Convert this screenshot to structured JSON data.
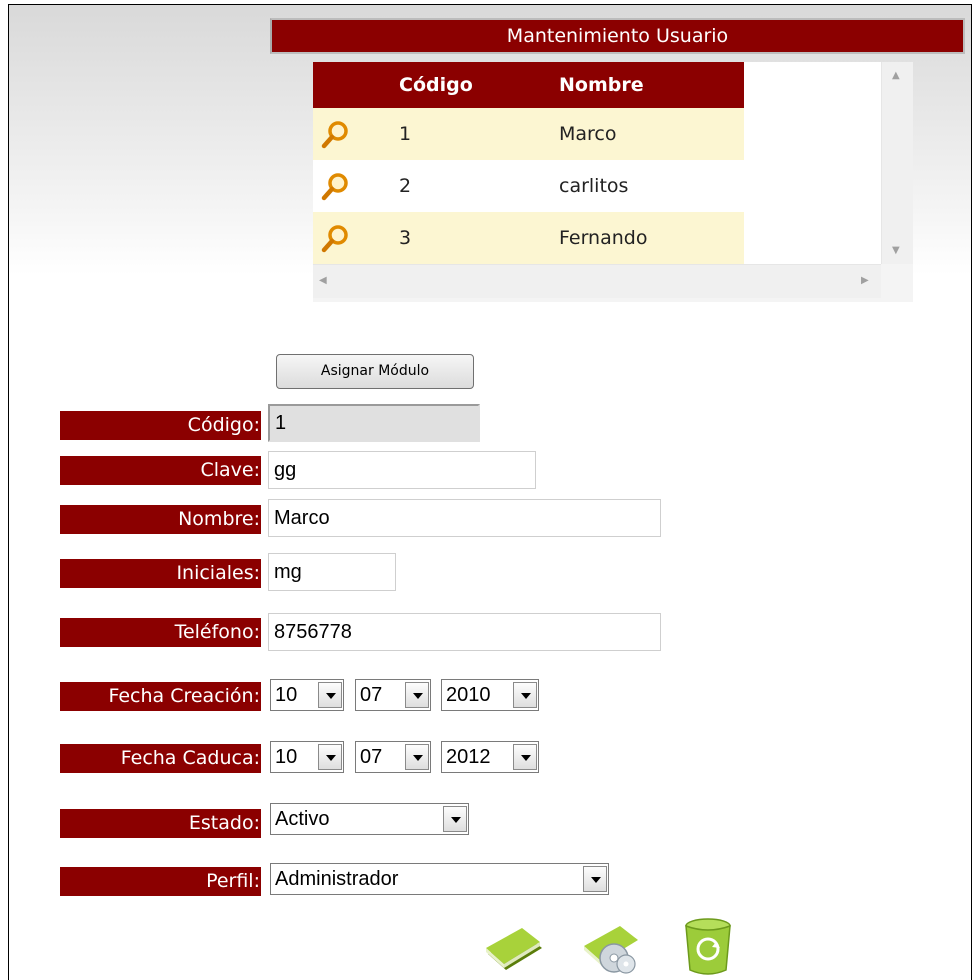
{
  "title": "Mantenimiento Usuario",
  "grid": {
    "columns": [
      "",
      "Código",
      "Nombre"
    ],
    "rows": [
      {
        "codigo": "1",
        "nombre": "Marco"
      },
      {
        "codigo": "2",
        "nombre": "carlitos"
      },
      {
        "codigo": "3",
        "nombre": "Fernando"
      }
    ]
  },
  "assign_button": "Asignar Módulo",
  "form": {
    "codigo": {
      "label": "Código:",
      "value": "1"
    },
    "clave": {
      "label": "Clave:",
      "value": "gg"
    },
    "nombre": {
      "label": "Nombre:",
      "value": "Marco"
    },
    "iniciales": {
      "label": "Iniciales:",
      "value": "mg"
    },
    "telefono": {
      "label": "Teléfono:",
      "value": "8756778"
    },
    "fecha_creacion": {
      "label": "Fecha Creación:",
      "day": "10",
      "month": "07",
      "year": "2010"
    },
    "fecha_caduca": {
      "label": "Fecha Caduca:",
      "day": "10",
      "month": "07",
      "year": "2012"
    },
    "estado": {
      "label": "Estado:",
      "value": "Activo"
    },
    "perfil": {
      "label": "Perfil:",
      "value": "Administrador"
    }
  },
  "actions": [
    "new-book-icon",
    "save-disk-icon",
    "recycle-bin-icon"
  ],
  "colors": {
    "header": "#8b0000",
    "row_alt": "#fcf6d2"
  }
}
